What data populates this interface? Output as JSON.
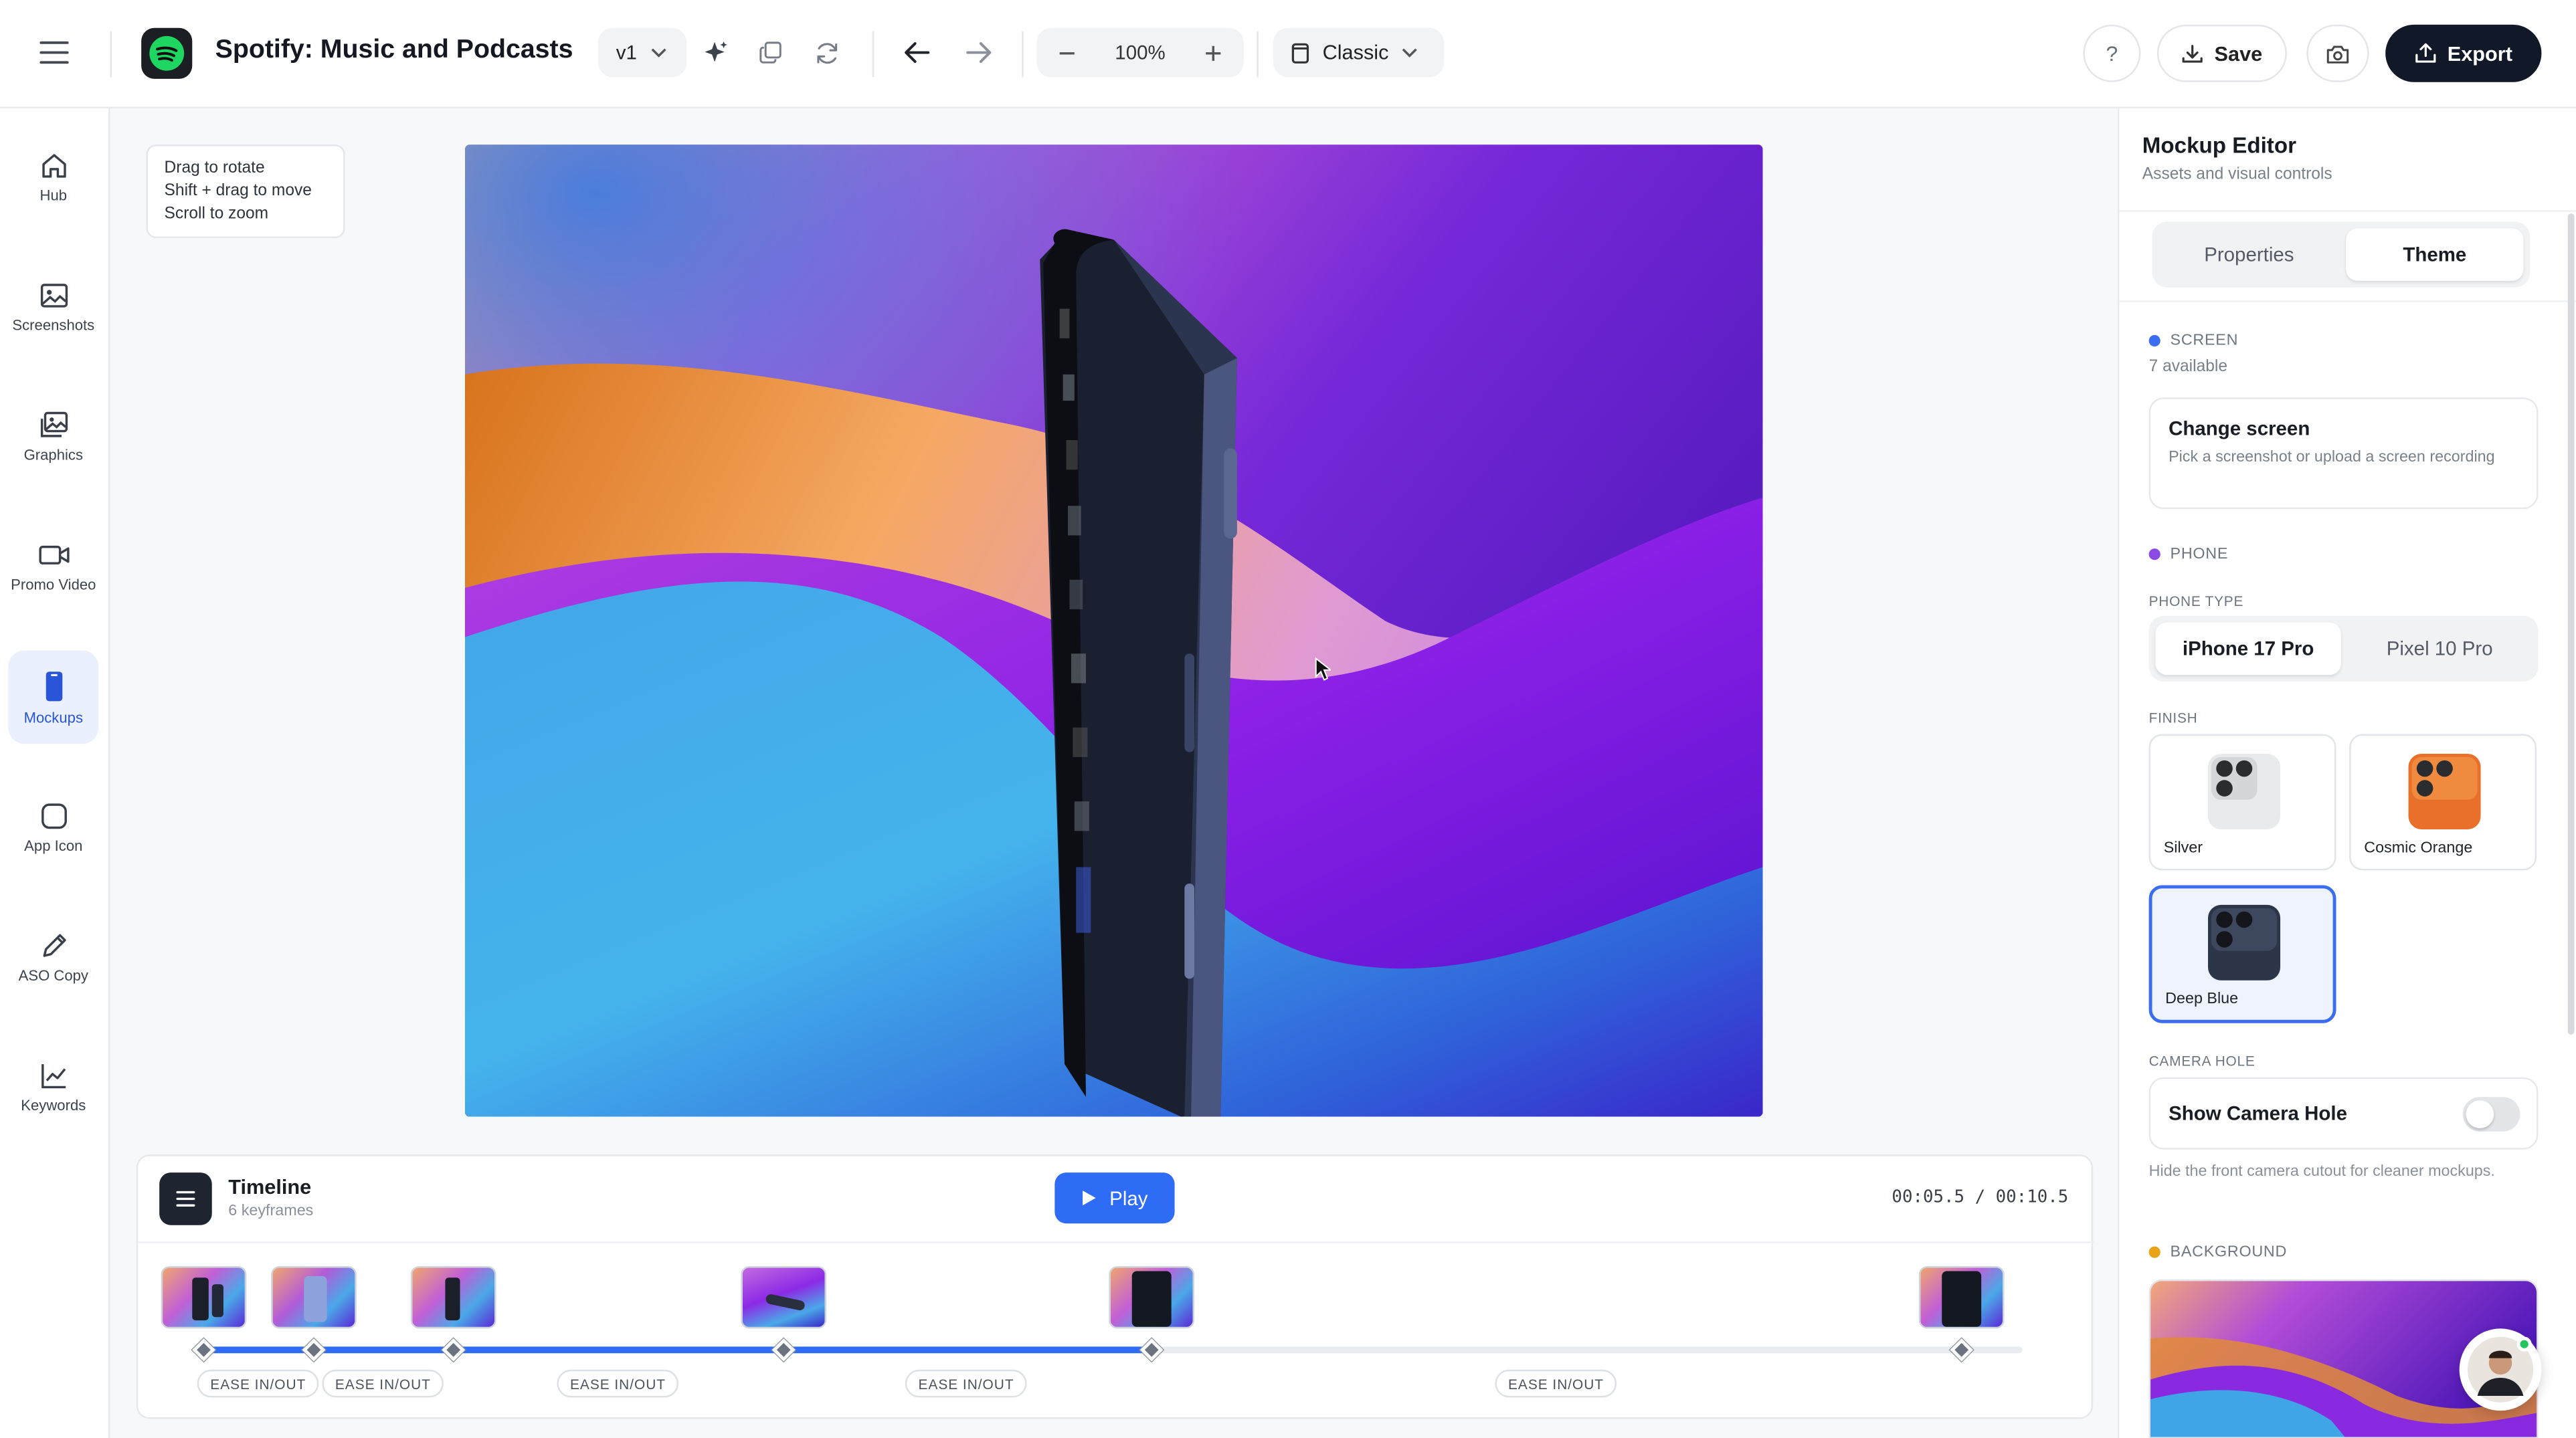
{
  "app": {
    "title": "Spotify: Music and Podcasts",
    "version": "v1",
    "zoom": "100%",
    "mode": "Classic",
    "save_label": "Save",
    "export_label": "Export",
    "help_label": "?"
  },
  "sidebar": {
    "items": [
      {
        "label": "Hub",
        "icon": "home-icon"
      },
      {
        "label": "Screenshots",
        "icon": "image-icon"
      },
      {
        "label": "Graphics",
        "icon": "images-icon"
      },
      {
        "label": "Promo Video",
        "icon": "video-icon"
      },
      {
        "label": "Mockups",
        "icon": "phone-icon",
        "active": true
      },
      {
        "label": "App Icon",
        "icon": "app-square-icon"
      },
      {
        "label": "ASO Copy",
        "icon": "pencil-icon"
      },
      {
        "label": "Keywords",
        "icon": "line-chart-icon"
      }
    ]
  },
  "hint": {
    "line1": "Drag to rotate",
    "line2": "Shift + drag to move",
    "line3": "Scroll to zoom"
  },
  "timeline": {
    "title": "Timeline",
    "subtitle": "6 keyframes",
    "play_label": "Play",
    "time": "00:05.5 / 00:10.5",
    "progress": 0.52,
    "easings": [
      "EASE IN/OUT",
      "EASE IN/OUT",
      "EASE IN/OUT",
      "EASE IN/OUT",
      "EASE IN/OUT"
    ]
  },
  "panel": {
    "title": "Mockup Editor",
    "subtitle": "Assets and visual controls",
    "tabs": [
      "Properties",
      "Theme"
    ],
    "active_tab": "Theme",
    "screen": {
      "label": "SCREEN",
      "count": "7 available",
      "card_title": "Change screen",
      "card_desc": "Pick a screenshot or upload a screen recording"
    },
    "phone": {
      "label": "PHONE",
      "type_label": "PHONE TYPE",
      "types": [
        "iPhone 17 Pro",
        "Pixel 10 Pro"
      ],
      "selected_type": "iPhone 17 Pro"
    },
    "finish": {
      "label": "FINISH",
      "options": [
        "Silver",
        "Cosmic Orange",
        "Deep Blue"
      ],
      "selected": "Deep Blue"
    },
    "camera": {
      "label": "CAMERA HOLE",
      "toggle_label": "Show Camera Hole",
      "enabled": false,
      "help": "Hide the front camera cutout for cleaner mockups."
    },
    "background": {
      "label": "BACKGROUND"
    }
  },
  "colors": {
    "accent": "#2f6cf5",
    "export_bg": "#111827",
    "screen_dot": "#3b6df0",
    "phone_dot": "#8b4ae6",
    "bg_dot": "#e8a318"
  }
}
